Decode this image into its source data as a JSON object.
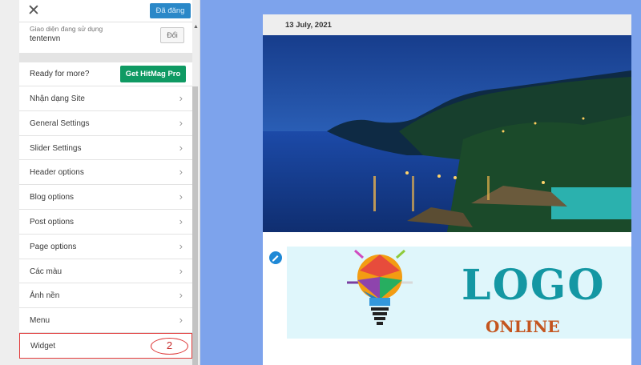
{
  "header": {
    "close_icon": "close-icon",
    "publish_label": "Đã đăng"
  },
  "theme": {
    "label": "Giao diện đang sử dụng",
    "name": "tentenvn",
    "change_label": "Đổi"
  },
  "promo": {
    "text": "Ready for more?",
    "button_label": "Get HitMag Pro"
  },
  "menu": {
    "items": [
      {
        "label": "Nhận dạng Site"
      },
      {
        "label": "General Settings"
      },
      {
        "label": "Slider Settings"
      },
      {
        "label": "Header options"
      },
      {
        "label": "Blog options"
      },
      {
        "label": "Post options"
      },
      {
        "label": "Page options"
      },
      {
        "label": "Các màu"
      },
      {
        "label": "Ảnh nền"
      },
      {
        "label": "Menu"
      },
      {
        "label": "Widget"
      }
    ],
    "widget_step": "2"
  },
  "preview": {
    "date": "13 July, 2021",
    "logo_text": "LOGO",
    "logo_subtext": "ONLINE"
  },
  "colors": {
    "accent_blue": "#2a88c8",
    "pro_green": "#0f9a63",
    "highlight_red": "#e23b3b",
    "preview_bg": "#7da3ec"
  }
}
